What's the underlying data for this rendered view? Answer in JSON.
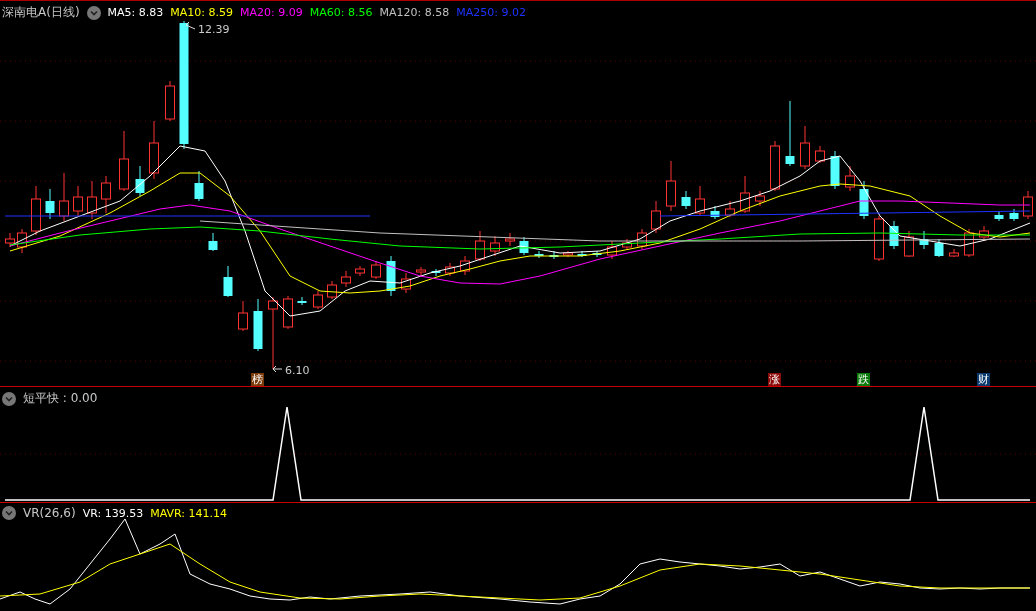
{
  "main": {
    "title": "深南电A(日线)",
    "indicators": [
      {
        "text": "MA5: 8.83",
        "color": "#ffffff"
      },
      {
        "text": "MA10: 8.59",
        "color": "#ffff00"
      },
      {
        "text": "MA20: 9.09",
        "color": "#ff00ff"
      },
      {
        "text": "MA60: 8.56",
        "color": "#00ff00"
      },
      {
        "text": "MA120: 8.58",
        "color": "#c0c0c0"
      },
      {
        "text": "MA250: 9.02",
        "color": "#1e32ff"
      }
    ],
    "high_label": "12.39",
    "low_label": "6.10",
    "markers": [
      {
        "text": "榜",
        "color": "#7a3a0a"
      },
      {
        "text": "涨",
        "color": "#8b0a0a"
      },
      {
        "text": "跌",
        "color": "#0a7a0a"
      },
      {
        "text": "财",
        "color": "#0a3a6e"
      }
    ]
  },
  "panel_2": {
    "title": "短平快 : 0.00"
  },
  "panel_3": {
    "title": "VR(26,6)",
    "indicators": [
      {
        "text": "VR: 139.53",
        "color": "#ffffff"
      },
      {
        "text": "MAVR: 141.14",
        "color": "#ffff00"
      }
    ]
  }
}
